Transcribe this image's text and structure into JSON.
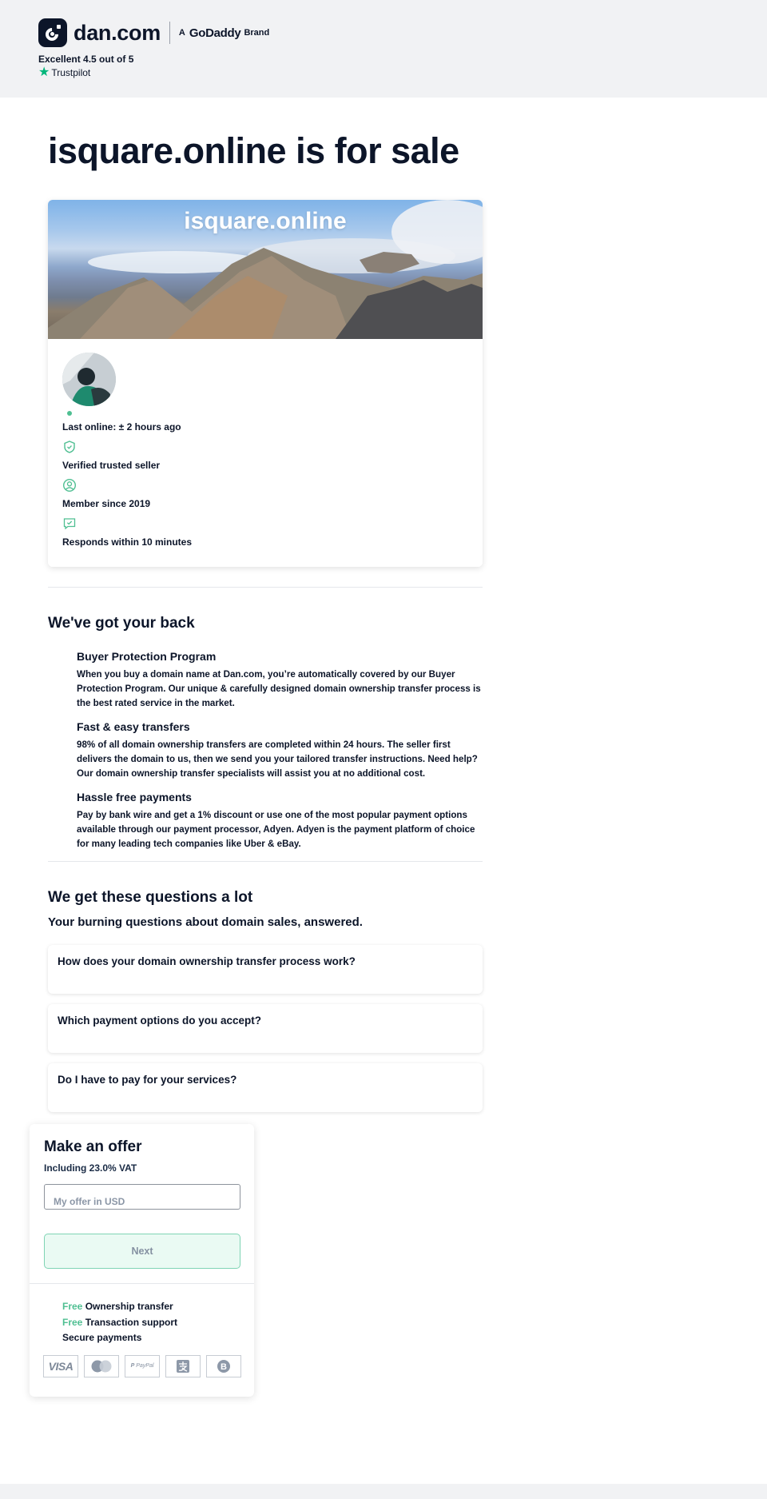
{
  "header": {
    "logo_text": "dan.com",
    "brand_prefix": "A",
    "brand_name": "GoDaddy",
    "brand_suffix": "Brand",
    "rating_text": "Excellent 4.5 out of 5",
    "trustpilot_label": "Trustpilot"
  },
  "page": {
    "title": "isquare.online is for sale",
    "domain": "isquare.online"
  },
  "seller": {
    "last_online": "Last online: ± 2 hours ago",
    "verified": "Verified trusted seller",
    "member_since": "Member since 2019",
    "responds": "Responds within 10 minutes",
    "online_color": "#4fbf92"
  },
  "protection": {
    "title": "We've got your back",
    "features": [
      {
        "title": "Buyer Protection Program",
        "text": "When you buy a domain name at Dan.com, you’re automatically covered by our Buyer Protection Program. Our unique & carefully designed domain ownership transfer process is the best rated service in the market."
      },
      {
        "title": "Fast & easy transfers",
        "text": "98% of all domain ownership transfers are completed within 24 hours. The seller first delivers the domain to us, then we send you your tailored transfer instructions. Need help? Our domain ownership transfer specialists will assist you at no additional cost."
      },
      {
        "title": "Hassle free payments",
        "text": "Pay by bank wire and get a 1% discount or use one of the most popular payment options available through our payment processor, Adyen. Adyen is the payment platform of choice for many leading tech companies like Uber & eBay."
      }
    ]
  },
  "faq": {
    "title": "We get these questions a lot",
    "subtitle": "Your burning questions about domain sales, answered.",
    "items": [
      "How does your domain ownership transfer process work?",
      "Which payment options do you accept?",
      "Do I have to pay for your services?"
    ]
  },
  "offer": {
    "title": "Make an offer",
    "vat": "Including 23.0% VAT",
    "input_placeholder": "My offer in USD",
    "input_value": "",
    "next_label": "Next",
    "perks": [
      {
        "free": "Free",
        "text": "Ownership transfer"
      },
      {
        "free": "Free",
        "text": "Transaction support"
      },
      {
        "free": "",
        "text": "Secure payments"
      }
    ],
    "payment_methods": [
      "visa-icon",
      "mastercard-icon",
      "paypal-icon",
      "alipay-icon",
      "bitcoin-icon"
    ],
    "visa_label": "VISA",
    "paypal_label": "PayPal",
    "accent_color": "#4fbf92"
  }
}
